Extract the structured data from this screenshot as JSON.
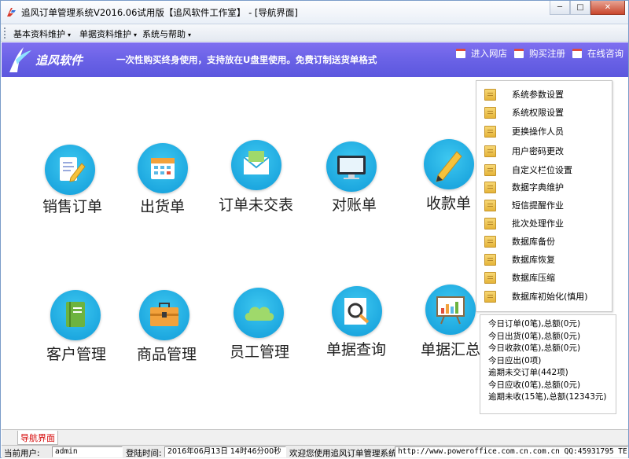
{
  "window": {
    "title": "追风订单管理系统V2016.06试用版【追风软件工作室】 - [导航界面]",
    "controls": [
      "─",
      "□",
      "✕"
    ]
  },
  "menubar": {
    "items": [
      {
        "label": "基本资料维护"
      },
      {
        "label": "单据资料维护"
      },
      {
        "label": "系统与帮助"
      }
    ],
    "arrow": "▾"
  },
  "banner": {
    "logo_text": "追风软件",
    "slogan": "一次性购买终身使用，支持放在U盘里使用。免费订制送货单格式",
    "links": [
      {
        "label": "进入网店"
      },
      {
        "label": "购买注册"
      },
      {
        "label": "在线咨询"
      }
    ],
    "colors": {
      "banner": "#6a62e6",
      "accent_red": "#e14b3c"
    }
  },
  "tiles": {
    "row1": [
      {
        "label": "销售订单",
        "icon": "edit-doc-icon"
      },
      {
        "label": "出货单",
        "icon": "calendar-icon"
      },
      {
        "label": "订单未交表",
        "icon": "mail-icon"
      },
      {
        "label": "对账单",
        "icon": "monitor-icon"
      },
      {
        "label": "收款单",
        "icon": "pencil-icon"
      }
    ],
    "row2": [
      {
        "label": "客户管理",
        "icon": "book-icon"
      },
      {
        "label": "商品管理",
        "icon": "briefcase-icon"
      },
      {
        "label": "员工管理",
        "icon": "cloud-icon"
      },
      {
        "label": "单据查询",
        "icon": "magnifier-icon"
      },
      {
        "label": "单据汇总",
        "icon": "chart-board-icon"
      }
    ]
  },
  "side_menu": {
    "items": [
      "系统参数设置",
      "系统权限设置",
      "更换操作人员",
      "用户密码更改",
      "自定义栏位设置",
      "数据字典维护",
      "短信提醒作业",
      "批次处理作业",
      "数据库备份",
      "数据库恢复",
      "数据库压缩",
      "数据库初始化(慎用)"
    ]
  },
  "stats": {
    "lines": [
      "今日订单(0笔),总额(0元)",
      "今日出货(0笔),总额(0元)",
      "今日收款(0笔),总额(0元)",
      "今日应出(0项)",
      "逾期未交订单(442项)",
      "今日应收(0笔),总额(0元)",
      "逾期未收(15笔),总额(12343元)"
    ]
  },
  "tabbar": {
    "active_tab": "导航界面"
  },
  "statusbar": {
    "user_label": "当前用户:",
    "user_value": "admin",
    "login_label": "登陆时间:",
    "login_value": "2016年06月13日 14时46分00秒",
    "welcome": "欢迎您使用追风订单管理系统",
    "contact": "http://www.poweroffice.com.cn.com.cn QQ:45931795 TEL:15"
  }
}
